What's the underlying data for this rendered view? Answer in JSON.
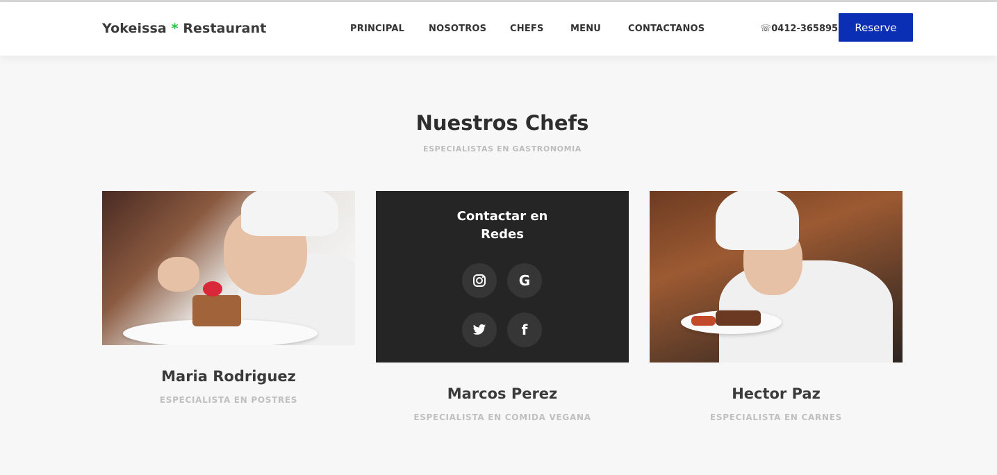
{
  "header": {
    "brand_part1": "Yokeissa",
    "brand_star": "*",
    "brand_part2": "Restaurant",
    "nav": [
      {
        "label": "PRINCIPAL"
      },
      {
        "label": "NOSOTROS"
      },
      {
        "label": "CHEFS"
      },
      {
        "label": "MENU"
      },
      {
        "label": "CONTACTANOS"
      }
    ],
    "phone_icon": "phone-icon",
    "phone": "☏0412-365895",
    "reserve_label": "Reserve"
  },
  "section": {
    "title": "Nuestros Chefs",
    "subtitle": "ESPECIALISTAS EN GASTRONOMIA"
  },
  "chefs": [
    {
      "name": "Maria Rodriguez",
      "role": "ESPECIALISTA EN POSTRES"
    },
    {
      "name": "Marcos Perez",
      "role": "ESPECIALISTA EN COMIDA VEGANA",
      "overlay_title_line1": "Contactar en",
      "overlay_title_line2": "Redes"
    },
    {
      "name": "Hector Paz",
      "role": "ESPECIALISTA EN CARNES"
    }
  ],
  "social": {
    "icons": [
      "instagram-icon",
      "google-icon",
      "twitter-icon",
      "facebook-icon"
    ],
    "glyphs": {
      "instagram": "◎",
      "google": "G",
      "twitter": "✧",
      "facebook": "f"
    }
  },
  "colors": {
    "accent": "#0a2fb4",
    "brand_star": "#2fbf4a",
    "background": "#f7f7f7"
  }
}
